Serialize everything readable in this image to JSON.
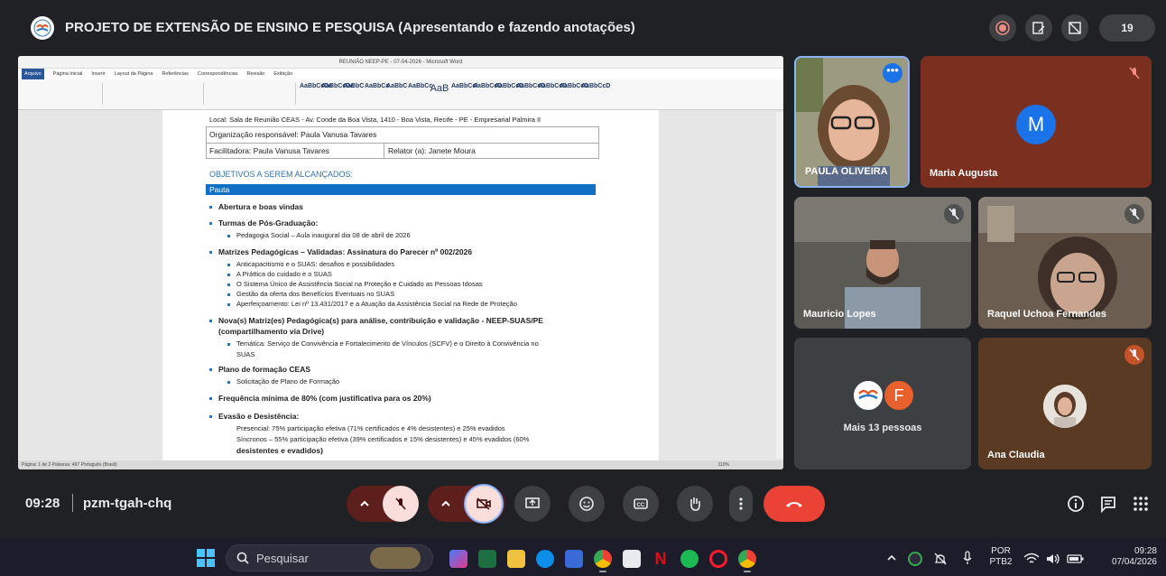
{
  "meeting": {
    "title": "PROJETO DE EXTENSÃO DE ENSINO E PESQUISA (Apresentando e fazendo anotações)",
    "participant_count": "19",
    "clock": "09:28",
    "code": "pzm-tgah-chq"
  },
  "word": {
    "window_title": "REUNIÃO NEEP-PE - 07-04-2026 - Microsoft Word",
    "tabs": [
      "Arquivo",
      "Página Inicial",
      "Inserir",
      "Layout da Página",
      "Referências",
      "Correspondências",
      "Revisão",
      "Exibição"
    ],
    "styles": [
      "AaBbCcDc",
      "AaBbCcDc",
      "AaBbC",
      "AaBbCc",
      "AaBbC",
      "AaBbCc",
      "AaB",
      "AaBbCcl",
      "AaBbCcD",
      "AaBbCcD",
      "AaBbCcD",
      "AaBbCcD",
      "AaBbCcD",
      "AaBbCcD"
    ],
    "status": "Página: 1 de 2   Palavras: 497   Português (Brasil)",
    "zoom": "110%"
  },
  "document": {
    "local": "Local: Sala de Reunião CEAS - Av. Conde da Boa Vista, 1410 - Boa Vista, Recife - PE - Empresarial Palmira II",
    "organizacao": "Organização responsável: Paula Vanusa Tavares",
    "facilitadora": "Facilitadora: Paula Vanusa Tavares",
    "relator": "Relator (a): Janete Moura",
    "objetivos_heading": "OBJETIVOS A SEREM ALCANÇADOS:",
    "pauta": "Pauta",
    "items": {
      "abertura": "Abertura e boas vindas",
      "turmas": "Turmas de Pós-Graduação:",
      "turmas_sub": "Pedagogia Social – Aula inaugural dia 08 de abril de 2026",
      "matrizes": "Matrizes Pedagógicas – Validadas: Assinatura do Parecer nº 002/2026",
      "matrizes_sub": [
        "Anticapacitismo e o SUAS: desafios e possibilidades",
        "A Práttica do cuidado e o SUAS",
        "O Sistema Único de Assistência Social na Proteção e Cuidado as Pessoas Idosas",
        "Gestão da oferta dos Benefícios Eventuais no SUAS",
        "Aperfeiçoamento: Lei nº 13.431/2017 e a Atuação da Assistência Social na Rede de Proteção"
      ],
      "novas_1": "Nova(s) Matriz(es) Pedagógica(s) para análise, contribuição e validação - NEEP-SUAS/PE",
      "novas_2": "(compartilhamento via Drive)",
      "novas_sub_1": "Temática: Serviço de Convivência e Fortalecimento de Vínculos (SCFV) e o Direito à Convivência no",
      "novas_sub_2": "SUAS",
      "plano": "Plano de formação CEAS",
      "plano_sub": "Solicitação de Plano de Formação",
      "frequencia": "Frequência mínima de 80% (com justificativa para os 20%)",
      "evasao": "Evasão e Desistência:",
      "presencial": "Presencial: 75% participação efetiva (71% certificados e 4% desistentes) e 25% evadidos",
      "sincronos": "Síncronos – 55% participação efetiva (39% certificados e 15% desistentes) e 45% evadidos (60%",
      "sincronos_2": "desistentes e evadidos)"
    }
  },
  "participants": {
    "paula": "PAULA OLIVEIRA",
    "maria": "Maria Augusta",
    "maria_initial": "M",
    "mauricio": "Mauricio Lopes",
    "raquel": "Raquel Uchoa Fernandes",
    "others": "Mais 13 pessoas",
    "others_initial": "F",
    "ana": "Ana Claudia"
  },
  "taskbar": {
    "search": "Pesquisar",
    "lang_1": "POR",
    "lang_2": "PTB2",
    "time": "09:28",
    "date": "07/04/2026"
  },
  "colors": {
    "bg": "#202124",
    "end_call": "#ea4335",
    "muted_btn": "#5c1f1c",
    "maria_tile": "#7a2f1f",
    "ana_tile": "#5a3a22",
    "word_blue": "#2b579a"
  }
}
